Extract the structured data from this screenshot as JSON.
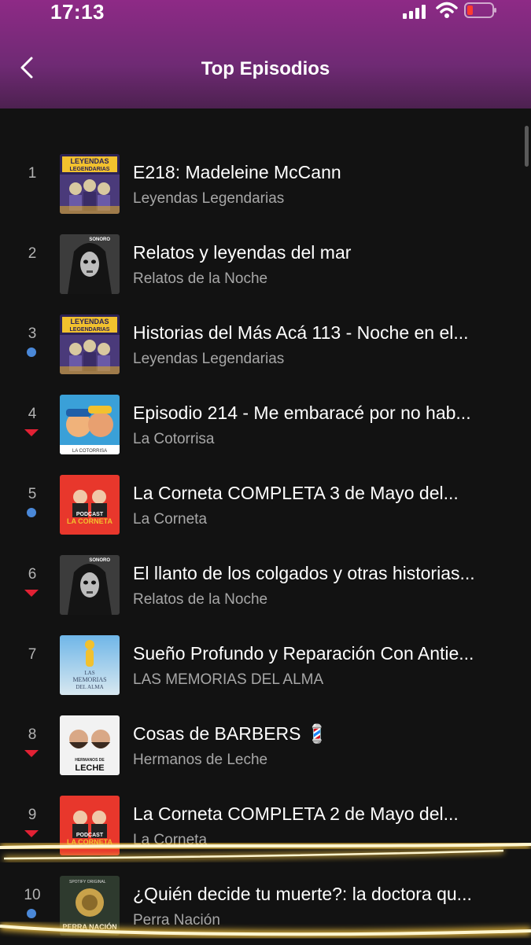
{
  "status": {
    "time": "17:13"
  },
  "header": {
    "title": "Top Episodios"
  },
  "episodes": [
    {
      "rank": "1",
      "title": "E218: Madeleine McCann",
      "show": "Leyendas Legendarias",
      "indicator": "none",
      "art": "leyendas"
    },
    {
      "rank": "2",
      "title": "Relatos y leyendas del mar",
      "show": "Relatos de la Noche",
      "indicator": "none",
      "art": "relatos"
    },
    {
      "rank": "3",
      "title": "Historias del Más Acá 113 - Noche en el...",
      "show": "Leyendas Legendarias",
      "indicator": "new",
      "art": "leyendas"
    },
    {
      "rank": "4",
      "title": "Episodio 214 - Me embaracé por no hab...",
      "show": "La Cotorrisa",
      "indicator": "down",
      "art": "cotorrisa"
    },
    {
      "rank": "5",
      "title": "La Corneta COMPLETA 3 de Mayo del...",
      "show": "La Corneta",
      "indicator": "new",
      "art": "corneta"
    },
    {
      "rank": "6",
      "title": "El llanto de los colgados y otras historias...",
      "show": "Relatos de la Noche",
      "indicator": "down",
      "art": "relatos"
    },
    {
      "rank": "7",
      "title": "Sueño Profundo y Reparación Con Antie...",
      "show": "LAS MEMORIAS DEL ALMA",
      "indicator": "none",
      "art": "memorias"
    },
    {
      "rank": "8",
      "title": "Cosas de BARBERS 💈",
      "show": "Hermanos de Leche",
      "indicator": "down",
      "art": "hermanos"
    },
    {
      "rank": "9",
      "title": "La Corneta COMPLETA 2 de Mayo del...",
      "show": "La Corneta",
      "indicator": "down",
      "art": "corneta"
    },
    {
      "rank": "10",
      "title": "¿Quién decide tu muerte?: la doctora qu...",
      "show": "Perra Nación",
      "indicator": "new",
      "art": "perra"
    }
  ],
  "art": {
    "leyendas": {
      "line1": "LEYENDAS",
      "line2": "LEGENDARIAS"
    },
    "relatos": {
      "tag": "SONORO"
    },
    "cotorrisa": {
      "tag": "LA COTORRISA"
    },
    "corneta": {
      "line1": "PODCAST",
      "line2": "LA CORNETA"
    },
    "memorias": {
      "line1": "LAS",
      "line2": "MEMORIAS",
      "line3": "DEL ALMA"
    },
    "hermanos": {
      "line1": "HERMANOS DE",
      "line2": "LECHE"
    },
    "perra": {
      "tag": "SPOTIFY ORIGINAL",
      "line1": "PERRA NACIÓN"
    }
  },
  "colors": {
    "header": "#8e2a86",
    "background": "#121212",
    "new_dot": "#4a88d8",
    "down_arrow": "#e22134"
  }
}
